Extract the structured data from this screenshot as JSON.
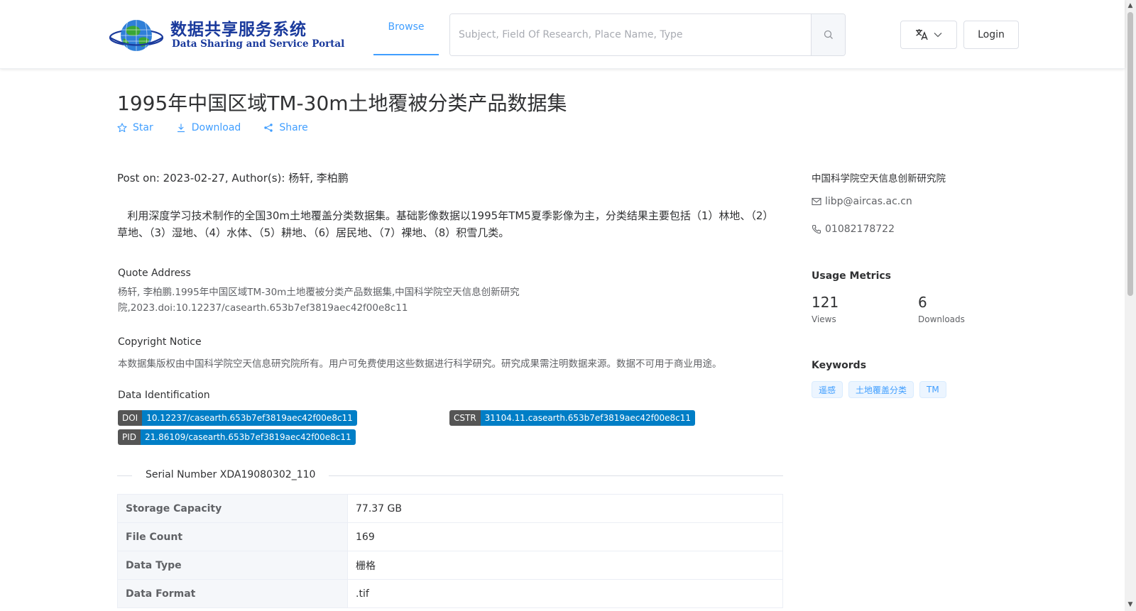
{
  "header": {
    "logo_cn": "数据共享服务系统",
    "logo_en": "Data Sharing and Service Portal",
    "nav_browse": "Browse",
    "search_placeholder": "Subject, Field Of Research, Place Name, Type",
    "login_label": "Login",
    "language_icon": "translate-icon"
  },
  "dataset": {
    "title": "1995年中国区域TM-30m土地覆被分类产品数据集",
    "actions": {
      "star": "Star",
      "download": "Download",
      "share": "Share"
    },
    "post_line": "Post on: 2023-02-27, Author(s): 杨轩, 李柏鹏",
    "abstract": "利用深度学习技术制作的全国30m土地覆盖分类数据集。基础影像数据以1995年TM5夏季影像为主，分类结果主要包括（1）林地、（2）草地、（3）湿地、（4）水体、（5）耕地、（6）居民地、（7）裸地、（8）积雪几类。",
    "quote_heading": "Quote Address",
    "quote_text": "杨轩, 李柏鹏.1995年中国区域TM-30m土地覆被分类产品数据集,中国科学院空天信息创新研究院,2023.doi:10.12237/casearth.653b7ef3819aec42f00e8c11",
    "copyright_heading": "Copyright Notice",
    "copyright_text": "本数据集版权由中国科学院空天信息研究院所有。用户可免费使用这些数据进行科学研究。研究成果需注明数据来源。数据不可用于商业用途。",
    "identification_heading": "Data Identification",
    "identifiers": [
      {
        "key": "DOI",
        "value": "10.12237/casearth.653b7ef3819aec42f00e8c11"
      },
      {
        "key": "CSTR",
        "value": "31104.11.casearth.653b7ef3819aec42f00e8c11"
      },
      {
        "key": "PID",
        "value": "21.86109/casearth.653b7ef3819aec42f00e8c11"
      }
    ],
    "serial_number": "Serial Number XDA19080302_110",
    "info_table": [
      {
        "key": "Storage Capacity",
        "value": "77.37 GB"
      },
      {
        "key": "File Count",
        "value": "169"
      },
      {
        "key": "Data Type",
        "value": "栅格"
      },
      {
        "key": "Data Format",
        "value": ".tif"
      }
    ]
  },
  "sidebar": {
    "organization": "中国科学院空天信息创新研究院",
    "email": "libp@aircas.ac.cn",
    "phone": "01082178722",
    "usage_heading": "Usage Metrics",
    "views_count": "121",
    "views_label": "Views",
    "downloads_count": "6",
    "downloads_label": "Downloads",
    "keywords_heading": "Keywords",
    "keywords": [
      "遥感",
      "土地覆盖分类",
      "TM"
    ]
  },
  "colors": {
    "accent": "#409eff",
    "badge_key": "#555555",
    "badge_value": "#007ec6",
    "logo_blue": "#1a3a9c"
  }
}
